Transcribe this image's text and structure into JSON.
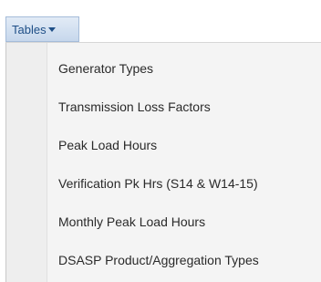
{
  "menu": {
    "button_label": "Tables",
    "caret_icon": "caret-down-icon",
    "items": [
      {
        "label": "Generator Types"
      },
      {
        "label": "Transmission Loss Factors"
      },
      {
        "label": "Peak Load Hours"
      },
      {
        "label": "Verification Pk Hrs (S14 & W14-15)"
      },
      {
        "label": "Monthly Peak Load Hours"
      },
      {
        "label": "DSASP Product/Aggregation Types"
      }
    ]
  },
  "colors": {
    "button_text": "#1f4f87",
    "button_bg": "#d3e0f1",
    "dropdown_bg": "#f4f4f4",
    "item_text": "#2a2a2a"
  }
}
